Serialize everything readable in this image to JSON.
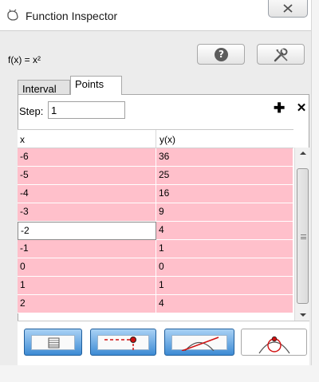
{
  "window": {
    "title": "Function Inspector",
    "close_symbol": "✕"
  },
  "function_label": "f(x) = x²",
  "buttons": {
    "help_icon": "question-mark-icon",
    "help_symbol": "?",
    "tools_icon": "tools-icon"
  },
  "tabs": [
    {
      "label": "Interval",
      "active": false
    },
    {
      "label": "Points",
      "active": true
    }
  ],
  "step": {
    "label": "Step:",
    "value": "1"
  },
  "actions": {
    "add_symbol": "✚",
    "remove_symbol": "✕"
  },
  "table": {
    "columns": [
      "x",
      "y(x)"
    ],
    "rows": [
      {
        "x": "-6",
        "y": "36"
      },
      {
        "x": "-5",
        "y": "25"
      },
      {
        "x": "-4",
        "y": "16"
      },
      {
        "x": "-3",
        "y": "9"
      },
      {
        "x": "-2",
        "y": "4"
      },
      {
        "x": "-1",
        "y": "1"
      },
      {
        "x": "0",
        "y": "0"
      },
      {
        "x": "1",
        "y": "1"
      },
      {
        "x": "2",
        "y": "4"
      }
    ],
    "editing_row": 4,
    "row_color": "#ffc0cb"
  },
  "toolbar": [
    {
      "name": "table-view-icon",
      "active": true
    },
    {
      "name": "trace-point-icon",
      "active": true
    },
    {
      "name": "tangent-line-icon",
      "active": true
    },
    {
      "name": "osculating-circle-icon",
      "active": false
    }
  ],
  "colors": {
    "accent_blue": "#3d8bd4",
    "highlight_red": "#d01010"
  }
}
